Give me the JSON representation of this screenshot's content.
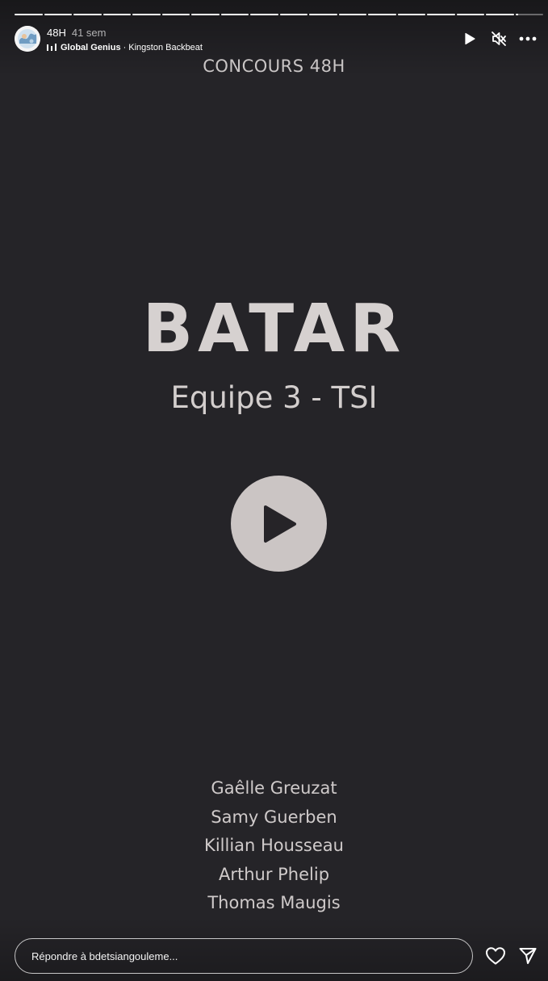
{
  "story": {
    "username": "48H",
    "time_ago": "41 sem",
    "music": {
      "track": "Global Genius",
      "separator": "·",
      "artist": "Kingston Backbeat"
    },
    "segments_total": 18,
    "segments_viewed": 17,
    "current_segment_progress": 0.1
  },
  "video": {
    "overline": "CONCOURS 48H",
    "title": "BATAR",
    "subtitle": "Equipe 3 - TSI",
    "team_members": [
      "Gaêlle Greuzat",
      "Samy Guerben",
      "Killian Housseau",
      "Arthur Phelip",
      "Thomas Maugis"
    ]
  },
  "footer": {
    "reply_placeholder": "Répondre à bdetsiangouleme..."
  },
  "icons": {
    "music": "music-bars-icon",
    "play": "play-icon",
    "mute": "muted-speaker-icon",
    "more": "more-options-icon",
    "video_play": "play-circle-icon",
    "like": "heart-icon",
    "share": "send-icon"
  },
  "colors": {
    "background": "#252428",
    "text": "#d3cfcf",
    "play_circle": "#cbc5c4"
  }
}
